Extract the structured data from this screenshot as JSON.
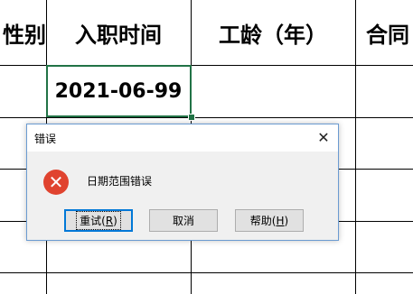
{
  "sheet": {
    "headers": [
      "性别",
      "入职时间",
      "工龄（年）",
      "合同"
    ],
    "active_cell_value": "2021-06-99"
  },
  "dialog": {
    "title": "错误",
    "close_glyph": "✕",
    "icon": "error-icon",
    "icon_glyph": "✕",
    "message": "日期范围错误",
    "buttons": {
      "retry": {
        "label": "重试(",
        "hotkey": "R",
        "suffix": ")"
      },
      "cancel": {
        "label": "取消"
      },
      "help": {
        "label": "帮助(",
        "hotkey": "H",
        "suffix": ")"
      }
    },
    "colors": {
      "error_red": "#e0432f",
      "accent_blue": "#0078d7",
      "cell_green": "#217346"
    }
  }
}
